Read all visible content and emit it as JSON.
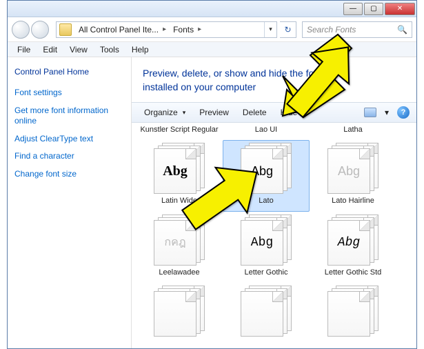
{
  "titlebar": {
    "min": "—",
    "max": "▢",
    "close": "✕"
  },
  "breadcrumb": {
    "item0": "All Control Panel Ite...",
    "item1": "Fonts"
  },
  "search": {
    "placeholder": "Search Fonts"
  },
  "menubar": {
    "file": "File",
    "edit": "Edit",
    "view": "View",
    "tools": "Tools",
    "help": "Help"
  },
  "sidebar": {
    "home": "Control Panel Home",
    "links": [
      "Font settings",
      "Get more font information online",
      "Adjust ClearType text",
      "Find a character",
      "Change font size"
    ]
  },
  "main": {
    "title_line1": "Preview, delete, or show and hide the fonts",
    "title_line2": "installed on your computer"
  },
  "toolbar": {
    "organize": "Organize",
    "preview": "Preview",
    "delete": "Delete",
    "hide": "Hide",
    "help": "?"
  },
  "fonts": {
    "row0": [
      {
        "name": "Kunstler Script Regular"
      },
      {
        "name": "Lao UI"
      },
      {
        "name": "Latha"
      }
    ],
    "row1": [
      {
        "name": "Latin Wide",
        "sample": "Abg",
        "cls": "bold-serif",
        "stack": true
      },
      {
        "name": "Lato",
        "sample": "Abg",
        "cls": "sans",
        "stack": true,
        "selected": true
      },
      {
        "name": "Lato Hairline",
        "sample": "Abg",
        "cls": "sans light",
        "stack": true
      }
    ],
    "row2": [
      {
        "name": "Leelawadee",
        "sample": "กคฎ",
        "cls": "thai",
        "stack": true
      },
      {
        "name": "Letter Gothic",
        "sample": "Abg",
        "cls": "mono",
        "stack": true
      },
      {
        "name": "Letter Gothic Std",
        "sample": "Abg",
        "cls": "mono italic",
        "stack": true
      }
    ]
  }
}
